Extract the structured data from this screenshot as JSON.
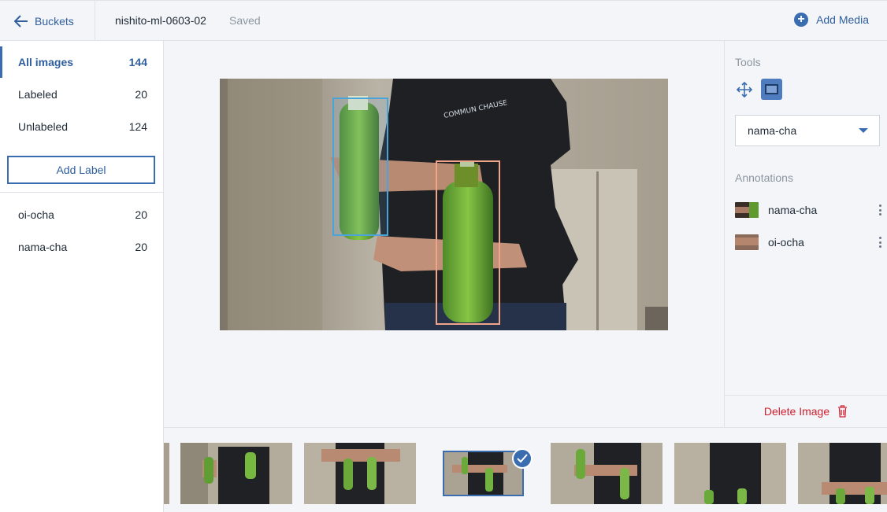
{
  "header": {
    "back_label": "Buckets",
    "title": "nishito-ml-0603-02",
    "status": "Saved",
    "add_media_label": "Add Media"
  },
  "sidebar": {
    "filters": [
      {
        "label": "All images",
        "count": "144",
        "active": true
      },
      {
        "label": "Labeled",
        "count": "20",
        "active": false
      },
      {
        "label": "Unlabeled",
        "count": "124",
        "active": false
      }
    ],
    "add_label_button": "Add Label",
    "labels": [
      {
        "label": "oi-ocha",
        "count": "20"
      },
      {
        "label": "nama-cha",
        "count": "20"
      }
    ]
  },
  "right_panel": {
    "tools_heading": "Tools",
    "selected_label": "nama-cha",
    "annotations_heading": "Annotations",
    "annotations": [
      {
        "label": "nama-cha"
      },
      {
        "label": "oi-ocha"
      }
    ],
    "delete_label": "Delete Image"
  },
  "colors": {
    "accent": "#3a6db0",
    "danger": "#d0202f",
    "box_oi_ocha": "#4aa3d9",
    "box_nama_cha": "#f0a58a"
  },
  "icons": {
    "back": "arrow-left-icon",
    "add_media": "plus-circle-icon",
    "move_tool": "move-arrows-icon",
    "box_tool": "bounding-box-icon",
    "dropdown": "caret-down-icon",
    "menu": "kebab-icon",
    "delete": "trash-icon",
    "selected": "checkmark-icon"
  }
}
